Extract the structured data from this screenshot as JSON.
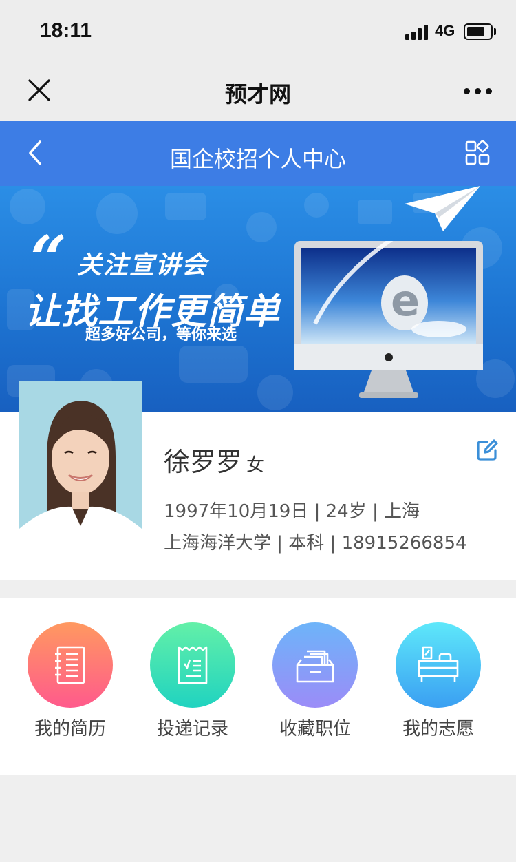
{
  "status_bar": {
    "time": "18:11",
    "network": "4G",
    "battery_level": 0.75
  },
  "wechat_nav": {
    "title": "预才网",
    "close_icon": "close-icon",
    "more_icon": "more-dots-icon"
  },
  "header": {
    "title": "国企校招个人中心",
    "back_icon": "chevron-left-icon",
    "grid_icon": "grid-icon"
  },
  "banner": {
    "line1": "关注宣讲会",
    "line2": "让找工作更简单",
    "line3": "超多好公司，等你来选"
  },
  "profile": {
    "name": "徐罗罗",
    "gender": "女",
    "line1": "1997年10月19日 | 24岁 | 上海",
    "line2": "上海海洋大学 | 本科 | 18915266854",
    "edit_icon": "edit-icon",
    "accent_color": "#3b8fd8"
  },
  "menu": {
    "items": [
      {
        "label": "我的简历",
        "icon": "resume-icon",
        "gradient": [
          "#ff9960",
          "#ff5a8c"
        ]
      },
      {
        "label": "投递记录",
        "icon": "receipt-icon",
        "gradient": [
          "#63f0a8",
          "#20d3c0"
        ]
      },
      {
        "label": "收藏职位",
        "icon": "archive-box-icon",
        "gradient": [
          "#6db4f9",
          "#9b8cf8"
        ]
      },
      {
        "label": "我的志愿",
        "icon": "desk-icon",
        "gradient": [
          "#5ee8fa",
          "#3a9ff2"
        ]
      }
    ]
  },
  "colors": {
    "header_blue": "#3d7de5",
    "nav_gray": "#ededed",
    "page_bg": "#efefef"
  }
}
